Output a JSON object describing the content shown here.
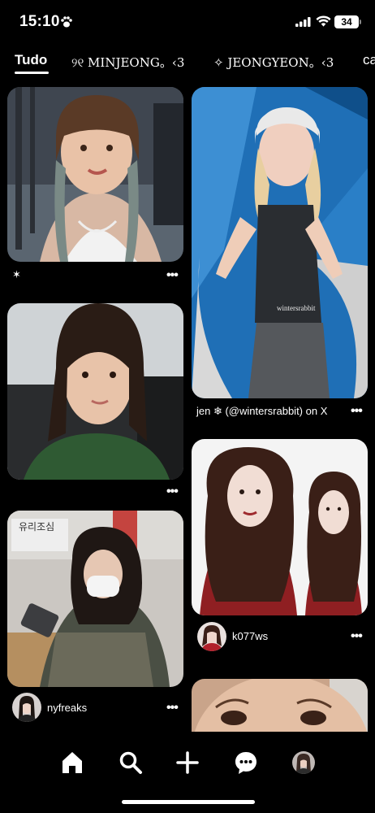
{
  "status_bar": {
    "time": "15:10",
    "battery": "34"
  },
  "tabs": [
    {
      "label": "Tudo",
      "active": true
    },
    {
      "label": "୨୧ MINJEONG。‹3",
      "active": false
    },
    {
      "label": "✧ JEONGYEON。‹3",
      "active": false
    },
    {
      "label": "ca",
      "active": false
    }
  ],
  "pins": {
    "pin1": {
      "caption": "✶"
    },
    "pin2": {
      "caption": "jen ❄ (@wintersrabbit) on X",
      "watermark": "wintersrabbit"
    },
    "pin3": {
      "caption": ""
    },
    "pin4": {
      "username": "k077ws"
    },
    "pin5": {
      "username": "nyfreaks",
      "sign_text": "유리조심"
    },
    "pin6": {}
  },
  "more_label": "•••",
  "nav": {
    "items": [
      "home-icon",
      "search-icon",
      "create-icon",
      "messages-icon",
      "profile-avatar"
    ]
  },
  "colors": {
    "background": "#000000",
    "text": "#ffffff"
  }
}
